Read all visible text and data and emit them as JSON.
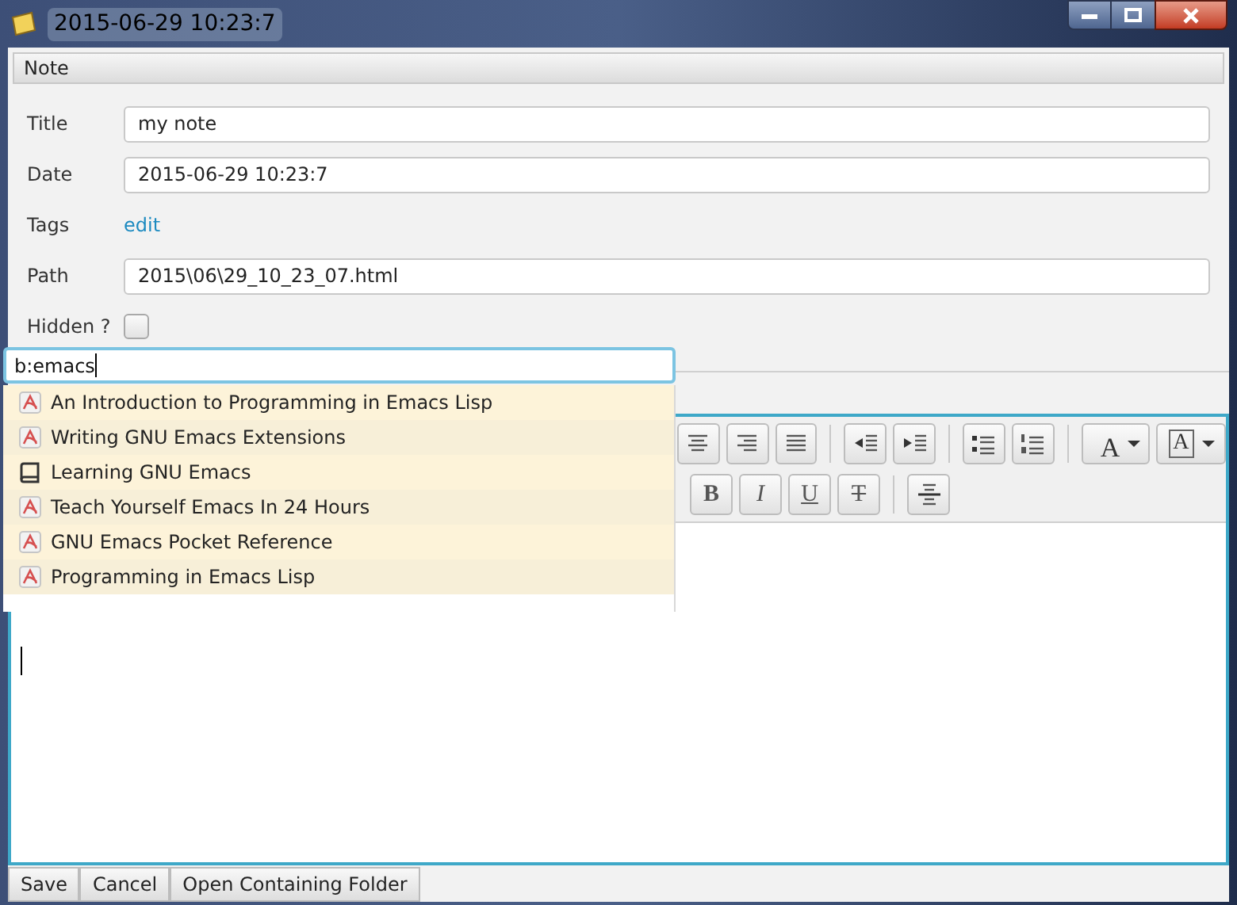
{
  "window": {
    "title": "2015-06-29 10:23:7"
  },
  "section": {
    "title": "Note"
  },
  "fields": [
    {
      "kind": "text",
      "label": "Title",
      "value": "my note"
    },
    {
      "kind": "text",
      "label": "Date",
      "value": "2015-06-29 10:23:7"
    },
    {
      "kind": "link",
      "label": "Tags",
      "value": "edit"
    },
    {
      "kind": "text",
      "label": "Path",
      "value": "2015\\06\\29_10_23_07.html"
    },
    {
      "kind": "checkbox",
      "label": "Hidden ?",
      "checked": false
    }
  ],
  "search": {
    "value": "b:emacs"
  },
  "suggestions": [
    {
      "kind": "pdf",
      "title": "An Introduction to Programming in Emacs Lisp"
    },
    {
      "kind": "pdf",
      "title": "Writing GNU Emacs Extensions"
    },
    {
      "kind": "book",
      "title": "Learning GNU Emacs"
    },
    {
      "kind": "pdf",
      "title": "Teach Yourself Emacs In 24 Hours"
    },
    {
      "kind": "pdf",
      "title": "GNU Emacs Pocket Reference"
    },
    {
      "kind": "pdf",
      "title": "Programming in Emacs Lisp"
    }
  ],
  "toolbar_row_1": [
    {
      "kind": "align-center"
    },
    {
      "kind": "align-right"
    },
    {
      "kind": "justify"
    },
    {
      "kind": "sep"
    },
    {
      "kind": "outdent"
    },
    {
      "kind": "indent"
    },
    {
      "kind": "sep"
    },
    {
      "kind": "bullets"
    },
    {
      "kind": "numbers"
    },
    {
      "kind": "sep"
    },
    {
      "kind": "text-color",
      "glyph": "A"
    },
    {
      "kind": "highlight",
      "glyph": "A"
    }
  ],
  "toolbar_row_2": [
    {
      "kind": "bold",
      "glyph": "B"
    },
    {
      "kind": "italic",
      "glyph": "I"
    },
    {
      "kind": "underline",
      "glyph": "U"
    },
    {
      "kind": "strike",
      "glyph": "T"
    },
    {
      "kind": "sep"
    },
    {
      "kind": "rule"
    }
  ],
  "buttons": [
    "Save",
    "Cancel",
    "Open Containing Folder"
  ]
}
